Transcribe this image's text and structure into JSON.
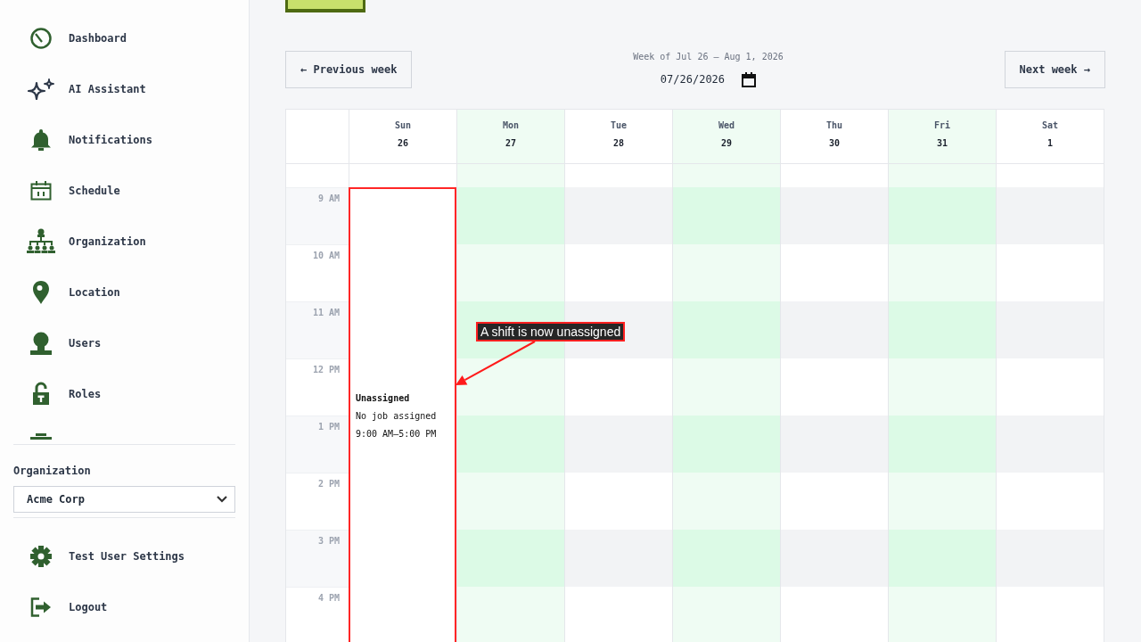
{
  "sidebar": {
    "nav_items": [
      {
        "label": "Dashboard"
      },
      {
        "label": "AI Assistant"
      },
      {
        "label": "Notifications"
      },
      {
        "label": "Schedule"
      },
      {
        "label": "Organization"
      },
      {
        "label": "Location"
      },
      {
        "label": "Users"
      },
      {
        "label": "Roles"
      }
    ],
    "organization": {
      "label": "Organization",
      "select": {
        "value": "Acme Corp"
      }
    },
    "footer_items": [
      {
        "label": "Test User Settings"
      },
      {
        "label": "Logout"
      }
    ]
  },
  "toolbar": {
    "previous_button": "← Previous week",
    "week_label": "Week of Jul 26 – Aug 1, 2026",
    "date_field": {
      "value": "07/26/2026"
    },
    "next_button": "Next week →"
  },
  "calendar": {
    "days": [
      {
        "name": "Sun",
        "date": "26",
        "shifts": [
          {
            "title": "Unassigned",
            "job": "No job assigned",
            "time": "9:00 AM–5:00 PM"
          }
        ]
      },
      {
        "name": "Mon",
        "date": "27"
      },
      {
        "name": "Tue",
        "date": "28"
      },
      {
        "name": "Wed",
        "date": "29"
      },
      {
        "name": "Thu",
        "date": "30"
      },
      {
        "name": "Fri",
        "date": "31"
      },
      {
        "name": "Sat",
        "date": "1"
      }
    ],
    "hours": [
      "9 AM",
      "10 AM",
      "11 AM",
      "12 PM",
      "1 PM",
      "2 PM",
      "3 PM",
      "4 PM"
    ]
  },
  "annotation": {
    "text": "A shift is now unassigned"
  }
}
